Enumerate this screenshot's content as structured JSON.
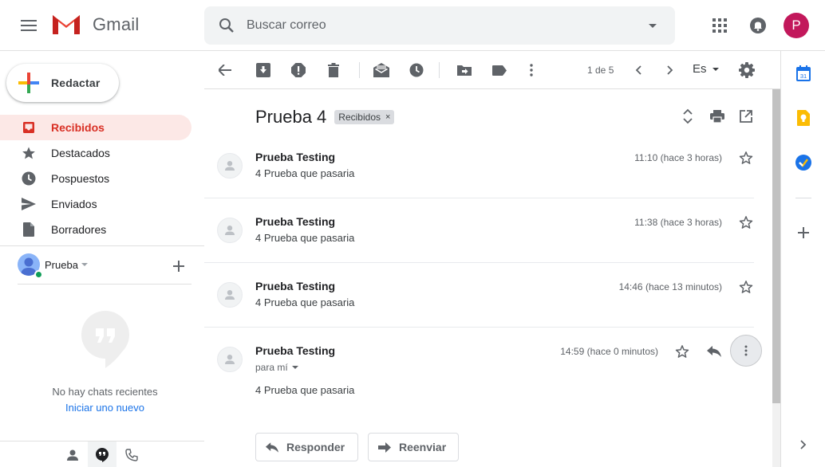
{
  "header": {
    "app_name": "Gmail",
    "search_placeholder": "Buscar correo",
    "avatar_initial": "P",
    "colors": {
      "avatar": "#c2185b",
      "accent_red": "#d93025"
    }
  },
  "sidebar": {
    "compose_label": "Redactar",
    "items": [
      {
        "label": "Recibidos",
        "icon": "inbox-icon",
        "active": true
      },
      {
        "label": "Destacados",
        "icon": "star-icon",
        "active": false
      },
      {
        "label": "Pospuestos",
        "icon": "clock-icon",
        "active": false
      },
      {
        "label": "Enviados",
        "icon": "send-icon",
        "active": false
      },
      {
        "label": "Borradores",
        "icon": "draft-icon",
        "active": false
      }
    ],
    "hangouts": {
      "user_name": "Prueba",
      "no_chats": "No hay chats recientes",
      "start_new": "Iniciar uno nuevo"
    }
  },
  "toolbar": {
    "pager": "1 de 5",
    "language": "Es"
  },
  "thread": {
    "subject": "Prueba 4",
    "label": "Recibidos",
    "messages": [
      {
        "sender": "Prueba Testing",
        "snippet": "4 Prueba que pasaria",
        "time": "11:10 (hace 3 horas)"
      },
      {
        "sender": "Prueba Testing",
        "snippet": "4 Prueba que pasaria",
        "time": "11:38 (hace 3 horas)"
      },
      {
        "sender": "Prueba Testing",
        "snippet": "4 Prueba que pasaria",
        "time": "14:46 (hace 13 minutos)"
      },
      {
        "sender": "Prueba Testing",
        "to": "para mí",
        "body": "4 Prueba que pasaria",
        "time": "14:59 (hace 0 minutos)"
      }
    ],
    "reply_label": "Responder",
    "forward_label": "Reenviar"
  }
}
